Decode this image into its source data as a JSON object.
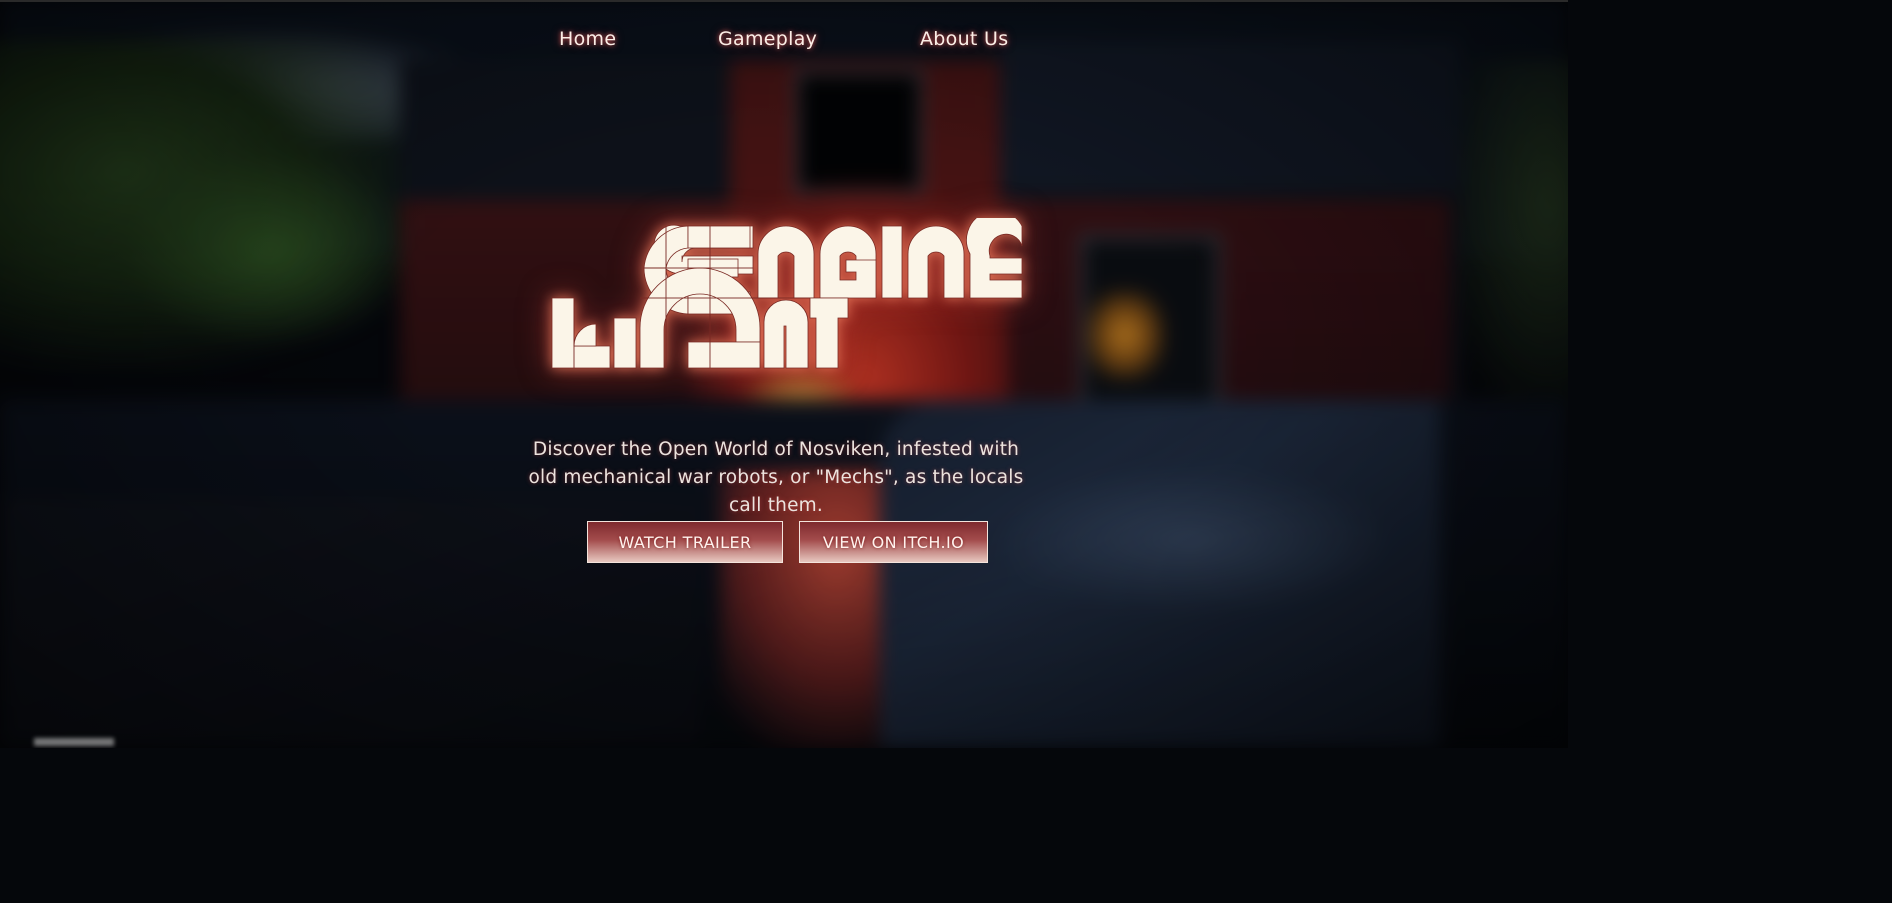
{
  "nav": {
    "items": [
      {
        "label": "Home"
      },
      {
        "label": "Gameplay"
      },
      {
        "label": "About Us"
      }
    ]
  },
  "hero": {
    "logo_text": "LIGHT ENGINE",
    "tagline": "Discover the Open World of Nosviken, infested with old mechanical war robots, or \"Mechs\", as the locals call them.",
    "buttons": {
      "trailer_label": "WATCH TRAILER",
      "itch_label": "VIEW ON ITCH.IO"
    }
  },
  "colors": {
    "text": "#fbeee6",
    "glow": "#d24a3c",
    "button_top": "#7e2a2e",
    "button_bottom": "#e8c8c0"
  }
}
